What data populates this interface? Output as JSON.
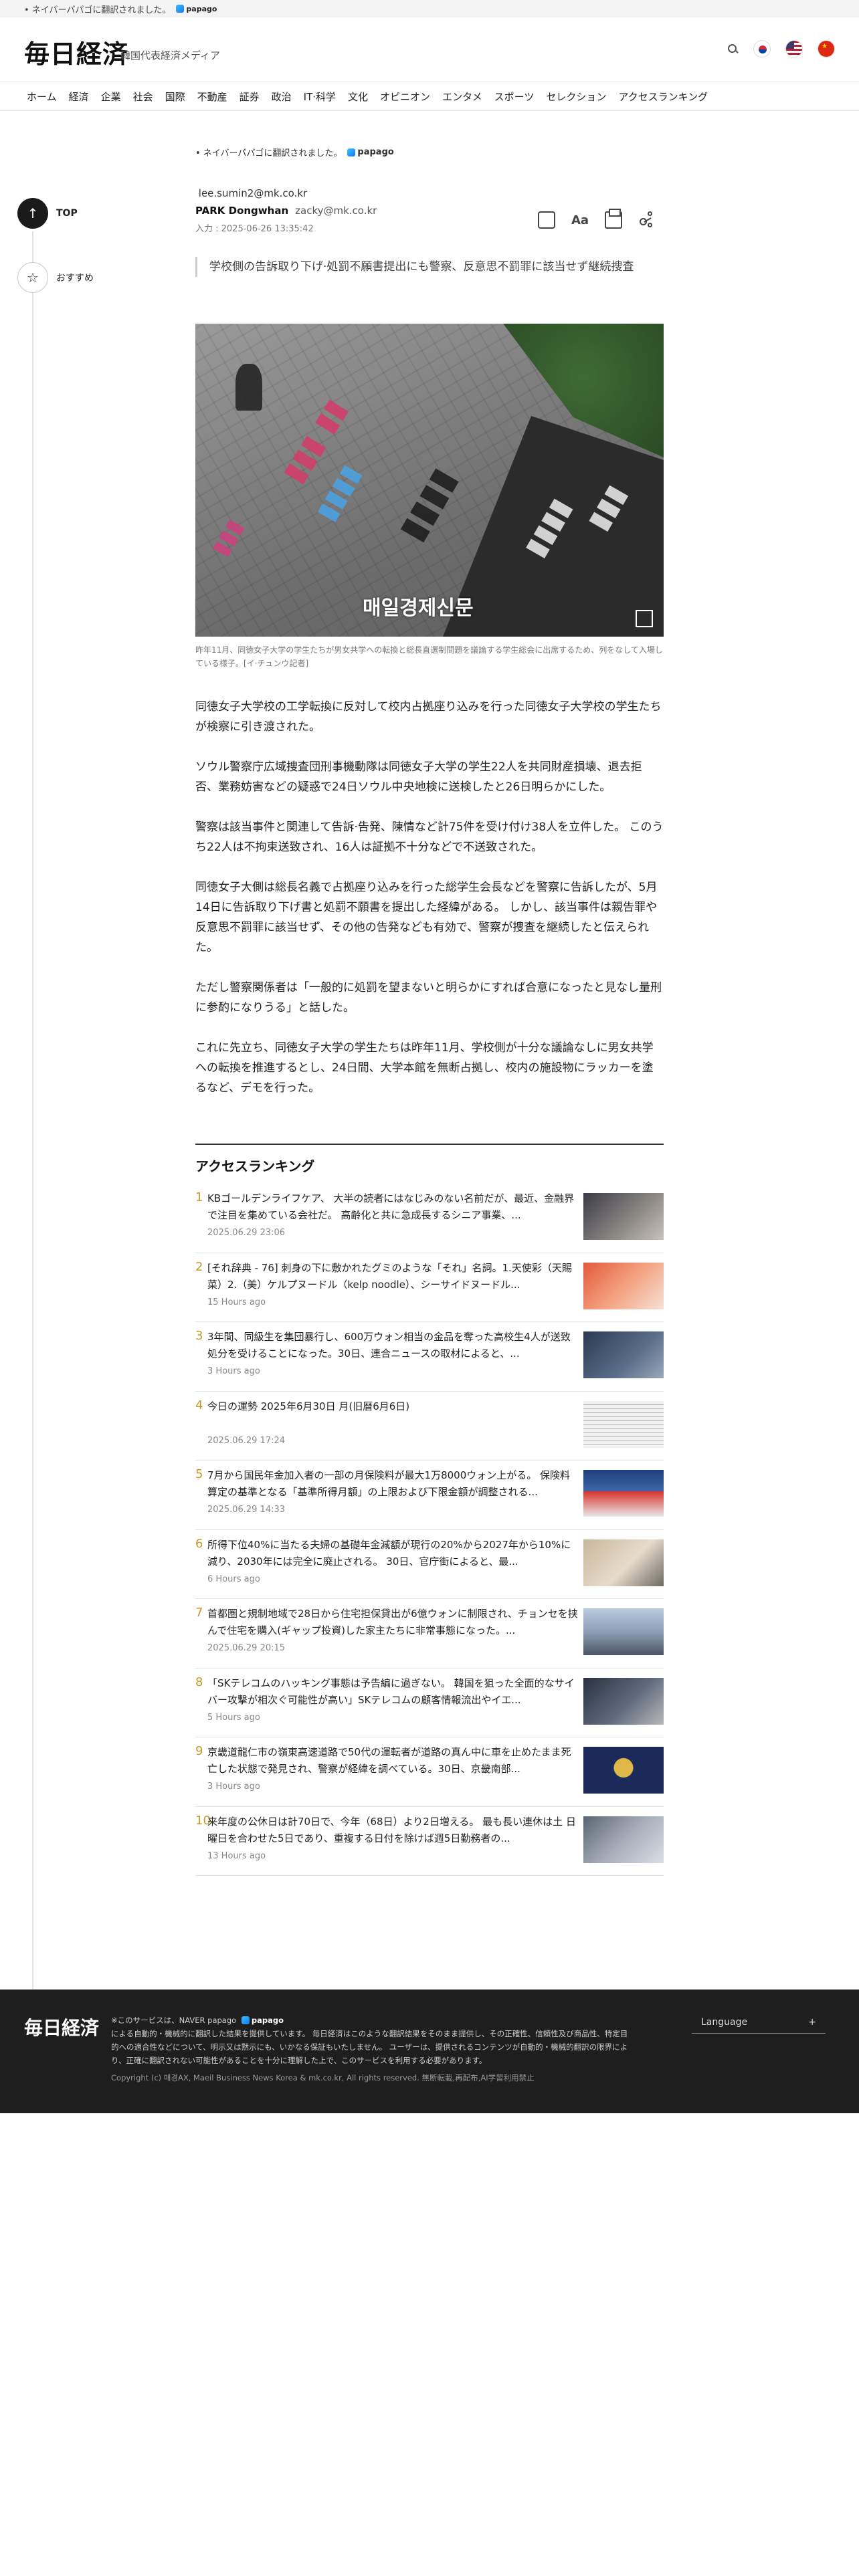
{
  "notice_bar": {
    "text": "• ネイバーパパゴに翻訳されました。",
    "papago": "papago"
  },
  "header": {
    "logo": "毎日経済",
    "tagline": "韓国代表経済メディア"
  },
  "nav": [
    "ホーム",
    "経済",
    "企業",
    "社会",
    "国際",
    "不動産",
    "証券",
    "政治",
    "IT·科学",
    "文化",
    "オピニオン",
    "エンタメ",
    "スポーツ",
    "セレクション",
    "アクセスランキング"
  ],
  "side": {
    "top_label": "TOP",
    "rec_label": "おすすめ"
  },
  "article": {
    "translated_note": "• ネイバーパパゴに翻訳されました。",
    "papago": "papago",
    "email_1": "lee.sumin2@mk.co.kr",
    "author": "PARK Dongwhan",
    "author_email": "zacky@mk.co.kr",
    "date": "入力 : 2025-06-26 13:35:42",
    "subtitle": "学校側の告訴取り下げ·処罰不願書提出にも警察、反意思不罰罪に該当せず継続捜査",
    "photo_watermark": "매일경제신문",
    "caption": "昨年11月、同徳女子大学の学生たちが男女共学への転換と総長直選制問題を議論する学生総会に出席するため、列をなして入場している様子。[イ·チュンウ記者]",
    "paragraphs": [
      "同徳女子大学校の工学転換に反対して校内占拠座り込みを行った同徳女子大学校の学生たちが検察に引き渡された。",
      "ソウル警察庁広域捜査団刑事機動隊は同徳女子大学の学生22人を共同財産損壊、退去拒否、業務妨害などの疑惑で24日ソウル中央地検に送検したと26日明らかにした。",
      "警察は該当事件と関連して告訴·告発、陳情など計75件を受け付け38人を立件した。 このうち22人は不拘束送致され、16人は証拠不十分などで不送致された。",
      "同徳女子大側は総長名義で占拠座り込みを行った総学生会長などを警察に告訴したが、5月14日に告訴取り下げ書と処罰不願書を提出した経緯がある。 しかし、該当事件は親告罪や反意思不罰罪に該当せず、その他の告発なども有効で、警察が捜査を継続したと伝えられた。",
      "ただし警察関係者は「一般的に処罰を望まないと明らかにすれば合意になったと見なし量刑に参酌になりうる」と話した。",
      "これに先立ち、同徳女子大学の学生たちは昨年11月、学校側が十分な議論なしに男女共学への転換を推進するとし、24日間、大学本館を無断占拠し、校内の施設物にラッカーを塗るなど、デモを行った。"
    ]
  },
  "ranking": {
    "title": "アクセスランキング",
    "items": [
      {
        "num": "1",
        "text": "KBゴールデンライフケア、 大半の読者にはなじみのない名前だが、最近、金融界で注目を集めている会社だ。 高齢化と共に急成長するシニア事業、...",
        "time": "2025.06.29 23:06"
      },
      {
        "num": "2",
        "text": "[それ辞典 - 76] 刺身の下に敷かれたグミのような「それ」名詞。1.天使彩（天賜菜）2.（美）ケルプヌードル（kelp noodle）、シーサイドヌードル...",
        "time": "15 Hours ago"
      },
      {
        "num": "3",
        "text": "3年間、同級生を集団暴行し、600万ウォン相当の金品を奪った高校生4人が送致処分を受けることになった。30日、連合ニュースの取材によると、...",
        "time": "3 Hours ago"
      },
      {
        "num": "4",
        "text": "今日の運勢 2025年6月30日 月(旧暦6月6日)",
        "time": "2025.06.29 17:24"
      },
      {
        "num": "5",
        "text": "7月から国民年金加入者の一部の月保険料が最大1万8000ウォン上がる。 保険料算定の基準となる「基準所得月額」の上限および下限金額が調整される...",
        "time": "2025.06.29 14:33"
      },
      {
        "num": "6",
        "text": "所得下位40%に当たる夫婦の基礎年金減額が現行の20%から2027年から10%に減り、2030年には完全に廃止される。 30日、官庁街によると、最...",
        "time": "6 Hours ago"
      },
      {
        "num": "7",
        "text": "首都圏と規制地域で28日から住宅担保貸出が6億ウォンに制限され、チョンセを挟んで住宅を購入(ギャップ投資)した家主たちに非常事態になった。...",
        "time": "2025.06.29 20:15"
      },
      {
        "num": "8",
        "text": "「SKテレコムのハッキング事態は予告編に過ぎない。 韓国を狙った全面的なサイバー攻撃が相次ぐ可能性が高い」SKテレコムの顧客情報流出やイエ...",
        "time": "5 Hours ago"
      },
      {
        "num": "9",
        "text": "京畿道龍仁市の嶺東高速道路で50代の運転者が道路の真ん中に車を止めたまま死亡した状態で発見され、警察が経緯を調べている。30日、京畿南部...",
        "time": "3 Hours ago"
      },
      {
        "num": "10",
        "text": "来年度の公休日は計70日で、今年（68日）より2日増える。 最も長い連休は土 日曜日を合わせた5日であり、重複する日付を除けば週5日勤務者の...",
        "time": "13 Hours ago"
      }
    ]
  },
  "footer": {
    "logo": "毎日経済",
    "notice_lead": "※このサービスは、NAVER papago",
    "papago": "papago",
    "notice_rest": "による自動的・機械的に翻訳した結果を提供しています。 毎日経済はこのような翻訳結果をそのまま提供し、その正確性、信頼性及び商品性、特定目的への適合性などについて、明示又は黙示にも、いかなる保証もいたしません。 ユーザーは、提供されるコンテンツが自動的・機械的翻訳の限界により、正確に翻訳されない可能性があることを十分に理解した上で、このサービスを利用する必要があります。",
    "copyright": "Copyright (c) 매경AX, Maeil Business News Korea & mk.co.kr, All rights reserved. 無断転載,再配布,AI学習利用禁止",
    "language": "Language",
    "language_plus": "+"
  },
  "colors": {
    "rank_number": "#c49a2a",
    "footer_bg": "#1e1e1e"
  }
}
